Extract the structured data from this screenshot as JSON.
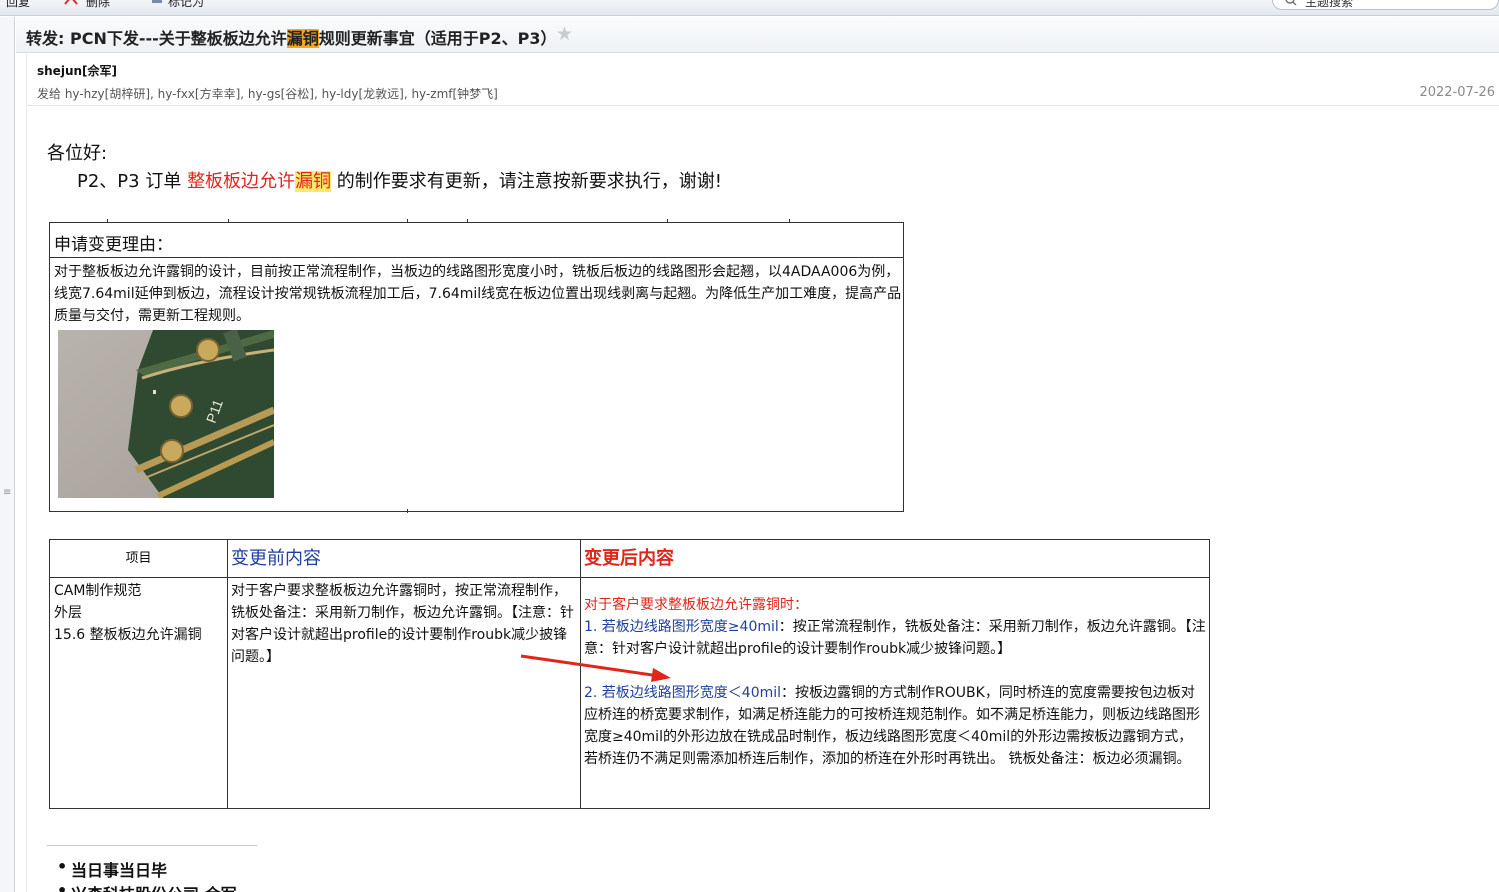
{
  "toolbar": {
    "items": [
      "回复",
      "删除",
      "标记为"
    ],
    "search_placeholder": "主题搜索"
  },
  "message": {
    "subject_pre": "转发: PCN下发---关于整板板边允许",
    "subject_hl": "漏铜",
    "subject_post": "规则更新事宜（适用于P2、P3）",
    "sender": "shejun[佘军]",
    "recipients": "发给 hy-hzy[胡梓研], hy-fxx[方幸幸], hy-gs[谷松], hy-ldy[龙敦远], hy-zmf[钟梦飞]",
    "date": "2022-07-26"
  },
  "body": {
    "greeting": "各位好:",
    "notice_pre": "P2、P3 订单 ",
    "notice_red": "整板板边允许",
    "notice_hl": "漏铜",
    "notice_post": " 的制作要求有更新，请注意按新要求执行，谢谢!",
    "reason_title": "申请变更理由：",
    "reason_text": "对于整板板边允许露铜的设计，目前按正常流程制作，当板边的线路图形宽度小时，铣板后板边的线路图形会起翘，以4ADAA006为例，线宽7.64mil延伸到板边，流程设计按常规铣板流程加工后，7.64mil线宽在板边位置出现线剥离与起翘。为降低生产加工难度，提高产品质量与交付，需更新工程规则。",
    "photo_label": "P11",
    "table": {
      "header_item": "项目",
      "header_before": "变更前内容",
      "header_after": "变更后内容",
      "item_line1": "CAM制作规范",
      "item_line2": "外层",
      "item_line3": "15.6 整板板边允许漏铜",
      "before_text": "对于客户要求整板板边允许露铜时，按正常流程制作，铣板处备注：采用新刀制作，板边允许露铜。【注意：针对客户设计就超出profile的设计要制作roubk减少披锋问题。】",
      "after_intro": "对于客户要求整板板边允许露铜时：",
      "after_p1_blue": "1. 若板边线路图形宽度≥40mil",
      "after_p1_text": "：按正常流程制作，铣板处备注：采用新刀制作，板边允许露铜。【注意：针对客户设计就超出profile的设计要制作roubk减少披锋问题。】",
      "after_p2_blue": "2. 若板边线路图形宽度＜40mil",
      "after_p2_text": "：按板边露铜的方式制作ROUBK，同时桥连的宽度需要按包边板对应桥连的桥宽要求制作，如满足桥连能力的可按桥连规范制作。如不满足桥连能力，则板边线路图形宽度≥40mil的外形边放在铣成品时制作，板边线路图形宽度＜40mil的外形边需按板边露铜方式，若桥连仍不满足则需添加桥连后制作，添加的桥连在外形时再铣出。 铣板处备注：板边必须漏铜。"
    },
    "signature": [
      "当日事当日毕",
      "兴森科技股份公司 佘军"
    ]
  },
  "colors": {
    "accent_red": "#e0251b",
    "link_blue": "#1f3f9e",
    "highlight_orange": "#f5a623",
    "highlight_yellow": "#ffe86b"
  }
}
